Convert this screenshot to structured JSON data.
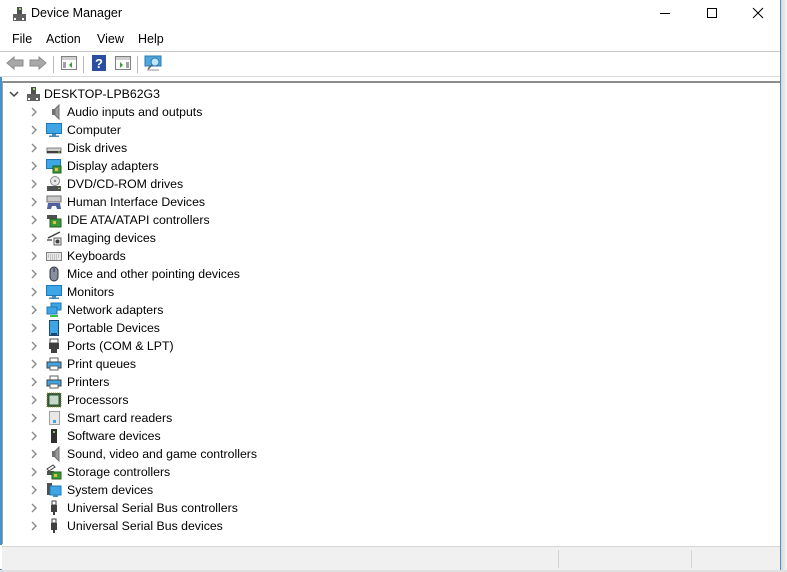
{
  "window": {
    "title": "Device Manager",
    "controls": {
      "minimize": "minimize",
      "maximize": "maximize",
      "close": "close"
    }
  },
  "menu": [
    "File",
    "Action",
    "View",
    "Help"
  ],
  "toolbar": {
    "buttons": [
      {
        "name": "back",
        "icon": "back-arrow-icon"
      },
      {
        "name": "forward",
        "icon": "forward-arrow-icon"
      },
      {
        "name": "show-hide-console-tree",
        "icon": "console-tree-icon"
      },
      {
        "name": "help",
        "icon": "help-icon"
      },
      {
        "name": "show-action-pane",
        "icon": "action-pane-icon"
      },
      {
        "name": "scan-hardware-changes",
        "icon": "monitor-scan-icon"
      }
    ]
  },
  "tree": {
    "root": {
      "label": "DESKTOP-LPB62G3",
      "expanded": true,
      "icon": "computer-tower-icon"
    },
    "categories": [
      {
        "label": "Audio inputs and outputs",
        "icon": "speaker-icon"
      },
      {
        "label": "Computer",
        "icon": "monitor-icon"
      },
      {
        "label": "Disk drives",
        "icon": "disk-drive-icon"
      },
      {
        "label": "Display adapters",
        "icon": "display-adapter-icon"
      },
      {
        "label": "DVD/CD-ROM drives",
        "icon": "dvd-drive-icon"
      },
      {
        "label": "Human Interface Devices",
        "icon": "hid-icon"
      },
      {
        "label": "IDE ATA/ATAPI controllers",
        "icon": "ide-controller-icon"
      },
      {
        "label": "Imaging devices",
        "icon": "camera-icon"
      },
      {
        "label": "Keyboards",
        "icon": "keyboard-icon"
      },
      {
        "label": "Mice and other pointing devices",
        "icon": "mouse-icon"
      },
      {
        "label": "Monitors",
        "icon": "monitor-icon"
      },
      {
        "label": "Network adapters",
        "icon": "network-adapter-icon"
      },
      {
        "label": "Portable Devices",
        "icon": "portable-device-icon"
      },
      {
        "label": "Ports (COM & LPT)",
        "icon": "port-icon"
      },
      {
        "label": "Print queues",
        "icon": "printer-icon"
      },
      {
        "label": "Printers",
        "icon": "printer-icon"
      },
      {
        "label": "Processors",
        "icon": "processor-icon"
      },
      {
        "label": "Smart card readers",
        "icon": "smart-card-reader-icon"
      },
      {
        "label": "Software devices",
        "icon": "software-device-icon"
      },
      {
        "label": "Sound, video and game controllers",
        "icon": "speaker-icon"
      },
      {
        "label": "Storage controllers",
        "icon": "storage-controller-icon"
      },
      {
        "label": "System devices",
        "icon": "system-devices-icon"
      },
      {
        "label": "Universal Serial Bus controllers",
        "icon": "usb-icon"
      },
      {
        "label": "Universal Serial Bus devices",
        "icon": "usb-icon"
      }
    ]
  },
  "statusbar": {
    "panes": [
      "",
      "",
      ""
    ]
  },
  "colors": {
    "accent": "#4a90c8",
    "chevron": "#8a8a8a",
    "statusbar_bg": "#f0f0f0"
  }
}
